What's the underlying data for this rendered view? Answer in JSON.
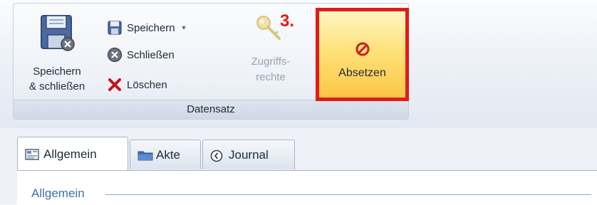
{
  "ribbon": {
    "group_label": "Datensatz",
    "save_close": {
      "line1": "Speichern",
      "line2": "& schließen",
      "icon": "floppy-disk-close-icon"
    },
    "save": {
      "label": "Speichern",
      "icon": "floppy-disk-icon",
      "dropdown": "▾"
    },
    "close": {
      "label": "Schließen",
      "icon": "close-circle-icon"
    },
    "delete": {
      "label": "Löschen",
      "icon": "red-x-icon",
      "glyph": "✖"
    },
    "rights": {
      "line1": "Zugriffs-",
      "line2": "rechte",
      "icon": "key-icon",
      "enabled": false
    },
    "absetzen": {
      "label": "Absetzen",
      "icon": "no-entry-icon",
      "highlighted": true
    },
    "step_badge": "3."
  },
  "tabs": [
    {
      "label": "Allgemein",
      "icon": "form-icon",
      "active": true
    },
    {
      "label": "Akte",
      "icon": "folder-icon",
      "active": false
    },
    {
      "label": "Journal",
      "icon": "clock-icon",
      "active": false
    }
  ],
  "section": {
    "heading": "Allgemein"
  },
  "colors": {
    "highlight_border": "#e41a1a",
    "absetzen_bg": "#ffe27a",
    "section_heading": "#3f6fb0"
  }
}
